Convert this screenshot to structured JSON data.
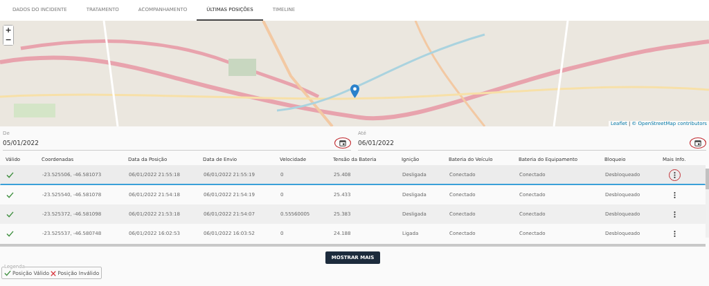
{
  "tabs": [
    {
      "label": "DADOS DO INCIDENTE",
      "selected": false
    },
    {
      "label": "TRATAMENTO",
      "selected": false
    },
    {
      "label": "ACOMPANHAMENTO",
      "selected": false
    },
    {
      "label": "ÚLTIMAS POSIÇÕES",
      "selected": true
    },
    {
      "label": "TIMELINE",
      "selected": false
    }
  ],
  "map": {
    "zoom_in": "+",
    "zoom_out": "−",
    "attribution_link": "Leaflet",
    "attribution_separator": "|",
    "attribution_text": "© OpenStreetMap contributors"
  },
  "date_fields": [
    {
      "label": "De",
      "value": "05/01/2022",
      "highlighted": true
    },
    {
      "label": "Até",
      "value": "06/01/2022",
      "highlighted": true
    }
  ],
  "table": {
    "columns": [
      "Válido",
      "Coordenadas",
      "Data da Posição",
      "Data de Envio",
      "Velocidade",
      "Tensão da Bateria",
      "Ignição",
      "Bateria do Veículo",
      "Bateria do Equipamento",
      "Bloqueio",
      "Mais Info."
    ],
    "rows": [
      {
        "valid": true,
        "selected": true,
        "highlighted": true,
        "cells": [
          "",
          "-23.525506, -46.581073",
          "06/01/2022 21:55:18",
          "06/01/2022 21:55:19",
          "0",
          "25.408",
          "Desligada",
          "Conectado",
          "Conectado",
          "Desbloqueado"
        ]
      },
      {
        "valid": true,
        "selected": false,
        "highlighted": false,
        "cells": [
          "",
          "-23.525540, -46.581078",
          "06/01/2022 21:54:18",
          "06/01/2022 21:54:19",
          "0",
          "25.433",
          "Desligada",
          "Conectado",
          "Conectado",
          "Desbloqueado"
        ]
      },
      {
        "valid": true,
        "selected": false,
        "highlighted": false,
        "cells": [
          "",
          "-23.525372, -46.581098",
          "06/01/2022 21:53:18",
          "06/01/2022 21:54:07",
          "0.55560005",
          "25.383",
          "Desligada",
          "Conectado",
          "Conectado",
          "Desbloqueado"
        ]
      },
      {
        "valid": true,
        "selected": false,
        "highlighted": false,
        "cells": [
          "",
          "-23.525537, -46.580748",
          "06/01/2022 16:02:53",
          "06/01/2022 16:03:52",
          "0",
          "24.188",
          "Ligada",
          "Conectado",
          "Conectado",
          "Desbloqueado"
        ]
      }
    ]
  },
  "more_button": "MOSTRAR MAIS",
  "legend": {
    "title": "Legenda",
    "items": [
      {
        "kind": "valid",
        "label": "Posição Válido"
      },
      {
        "kind": "invalid",
        "label": "Posição Inválido"
      }
    ]
  }
}
